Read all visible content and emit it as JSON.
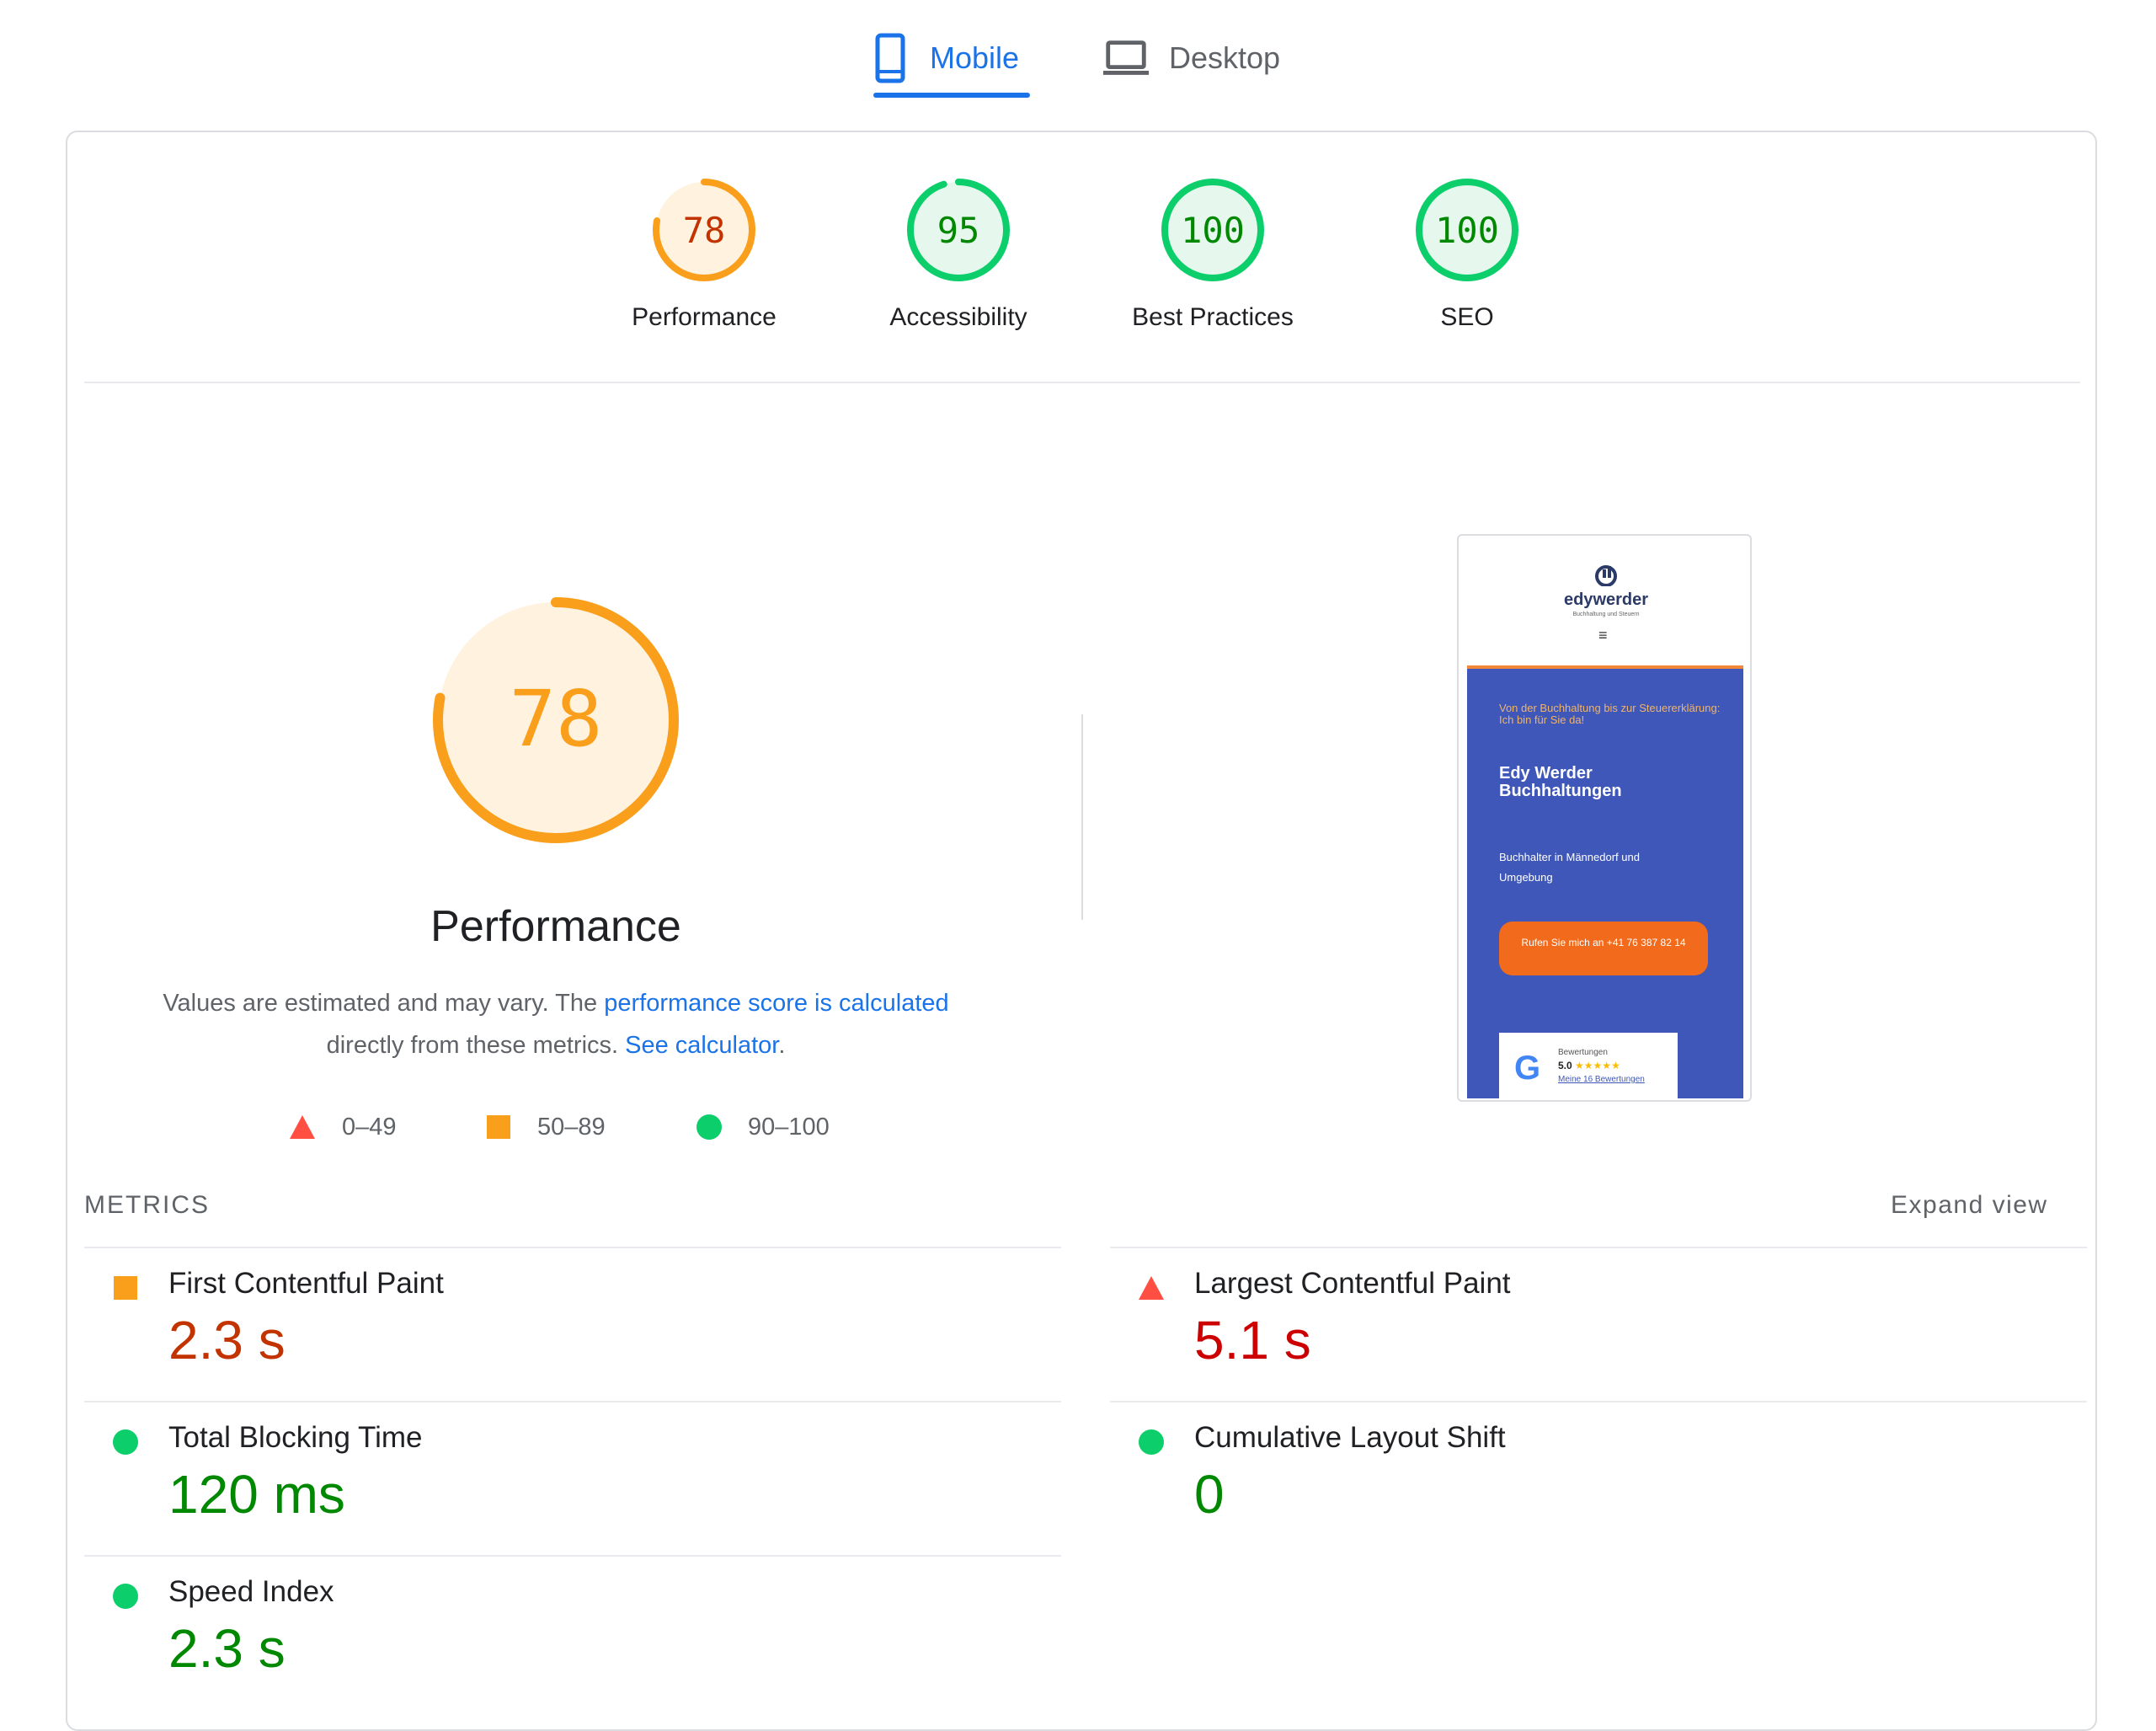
{
  "tabs": [
    {
      "label": "Mobile",
      "icon": "phone-icon",
      "active": true
    },
    {
      "label": "Desktop",
      "icon": "laptop-icon",
      "active": false
    }
  ],
  "categories": [
    {
      "label": "Performance",
      "score": "78",
      "fraction": 0.78,
      "rating": "average"
    },
    {
      "label": "Accessibility",
      "score": "95",
      "fraction": 0.95,
      "rating": "pass"
    },
    {
      "label": "Best Practices",
      "score": "100",
      "fraction": 1.0,
      "rating": "pass"
    },
    {
      "label": "SEO",
      "score": "100",
      "fraction": 1.0,
      "rating": "pass"
    }
  ],
  "colors": {
    "average": "#fa9f1c",
    "average_text": "#c33300",
    "average_bg": "#fff3e0",
    "pass": "#0cce6b",
    "pass_text": "#008800",
    "pass_bg": "#e6f8ee",
    "fail": "#ff4e42",
    "fail_text": "#cc0000",
    "link": "#1a73e8"
  },
  "performance": {
    "score": "78",
    "fraction": 0.78,
    "title": "Performance",
    "desc_prefix": "Values are estimated and may vary. The ",
    "desc_link1": "performance score is calculated",
    "desc_mid": " directly from these metrics. ",
    "desc_link2": "See calculator",
    "desc_suffix": "."
  },
  "legend": [
    {
      "shape": "triangle",
      "range": "0–49"
    },
    {
      "shape": "square",
      "range": "50–89"
    },
    {
      "shape": "circle",
      "range": "90–100"
    }
  ],
  "screenshot": {
    "logo_prefix": "edy",
    "logo_suffix": "werder",
    "logo_sub": "Buchhaltung und Steuern",
    "menu": "≡",
    "tagline": "Von der Buchhaltung bis zur Steuererklärung: Ich bin für Sie da!",
    "name": "Edy Werder Buchhaltungen",
    "subtitle": "Buchhalter in Männedorf und Umgebung",
    "cta": "Rufen Sie mich an +41 76 387 82 14",
    "review_title": "Bewertungen",
    "review_score": "5.0",
    "review_stars": "★★★★★",
    "review_link": "Meine 16 Bewertungen",
    "google_g": "G"
  },
  "metrics": {
    "heading": "METRICS",
    "expand": "Expand view",
    "items": [
      {
        "name": "First Contentful Paint",
        "value": "2.3 s",
        "rating": "average"
      },
      {
        "name": "Largest Contentful Paint",
        "value": "5.1 s",
        "rating": "fail"
      },
      {
        "name": "Total Blocking Time",
        "value": "120 ms",
        "rating": "pass"
      },
      {
        "name": "Cumulative Layout Shift",
        "value": "0",
        "rating": "pass"
      },
      {
        "name": "Speed Index",
        "value": "2.3 s",
        "rating": "pass"
      }
    ]
  }
}
